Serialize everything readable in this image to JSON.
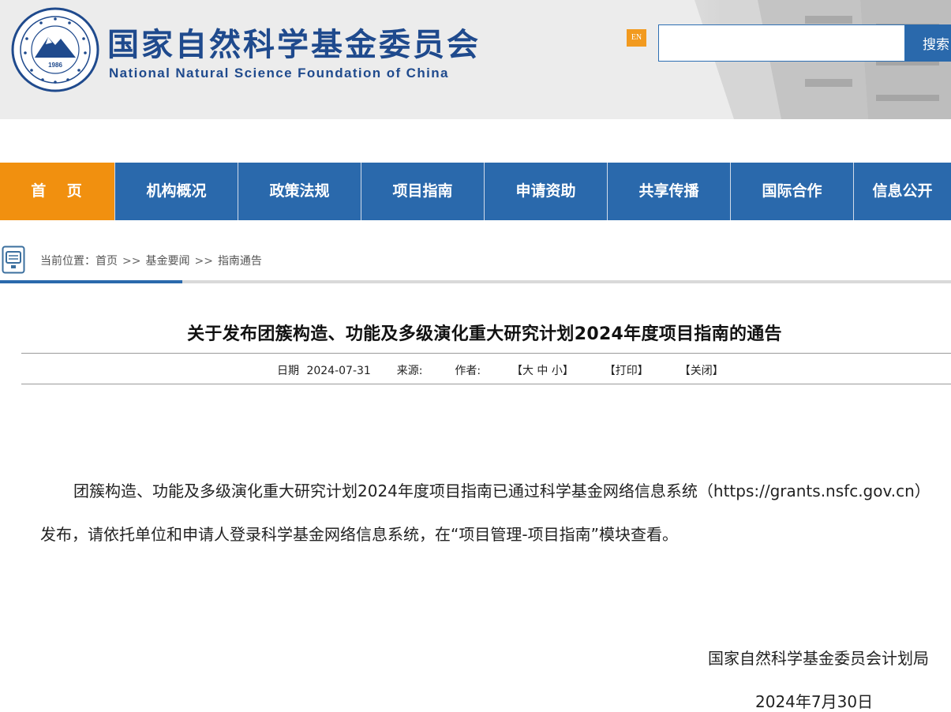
{
  "header": {
    "seal_year": "1986",
    "org_name_cn": "国家自然科学基金委员会",
    "org_name_en": "National Natural Science Foundation of China",
    "lang_switch": "EN",
    "search_placeholder": "",
    "search_button": "搜索"
  },
  "nav": {
    "items": [
      {
        "label": "首 页"
      },
      {
        "label": "机构概况"
      },
      {
        "label": "政策法规"
      },
      {
        "label": "项目指南"
      },
      {
        "label": "申请资助"
      },
      {
        "label": "共享传播"
      },
      {
        "label": "国际合作"
      },
      {
        "label": "信息公开"
      }
    ]
  },
  "breadcrumb": {
    "prefix": "当前位置：",
    "items": [
      "首页",
      "基金要闻",
      "指南通告"
    ],
    "separator": ">>"
  },
  "article": {
    "title": "关于发布团簇构造、功能及多级演化重大研究计划2024年度项目指南的通告",
    "meta": {
      "date_label": "日期",
      "date": "2024-07-31",
      "source_label": "来源:",
      "author_label": "作者:",
      "font_size_control": "【大 中 小】",
      "print": "【打印】",
      "close": "【关闭】"
    },
    "paragraph": "团簇构造、功能及多级演化重大研究计划2024年度项目指南已通过科学基金网络信息系统（https://grants.nsfc.gov.cn）发布，请依托单位和申请人登录科学基金网络信息系统，在“项目管理-项目指南”模块查看。",
    "signature_org": "国家自然科学基金委员会计划局",
    "signature_date": "2024年7月30日"
  },
  "colors": {
    "brand_blue": "#2a69ac",
    "logo_blue": "#1f4a8d",
    "home_orange": "#f1900f",
    "en_badge_orange": "#f29a1f"
  },
  "icons": {
    "seal": "nsfc-seal-logo",
    "breadcrumb": "location-marker-icon"
  }
}
